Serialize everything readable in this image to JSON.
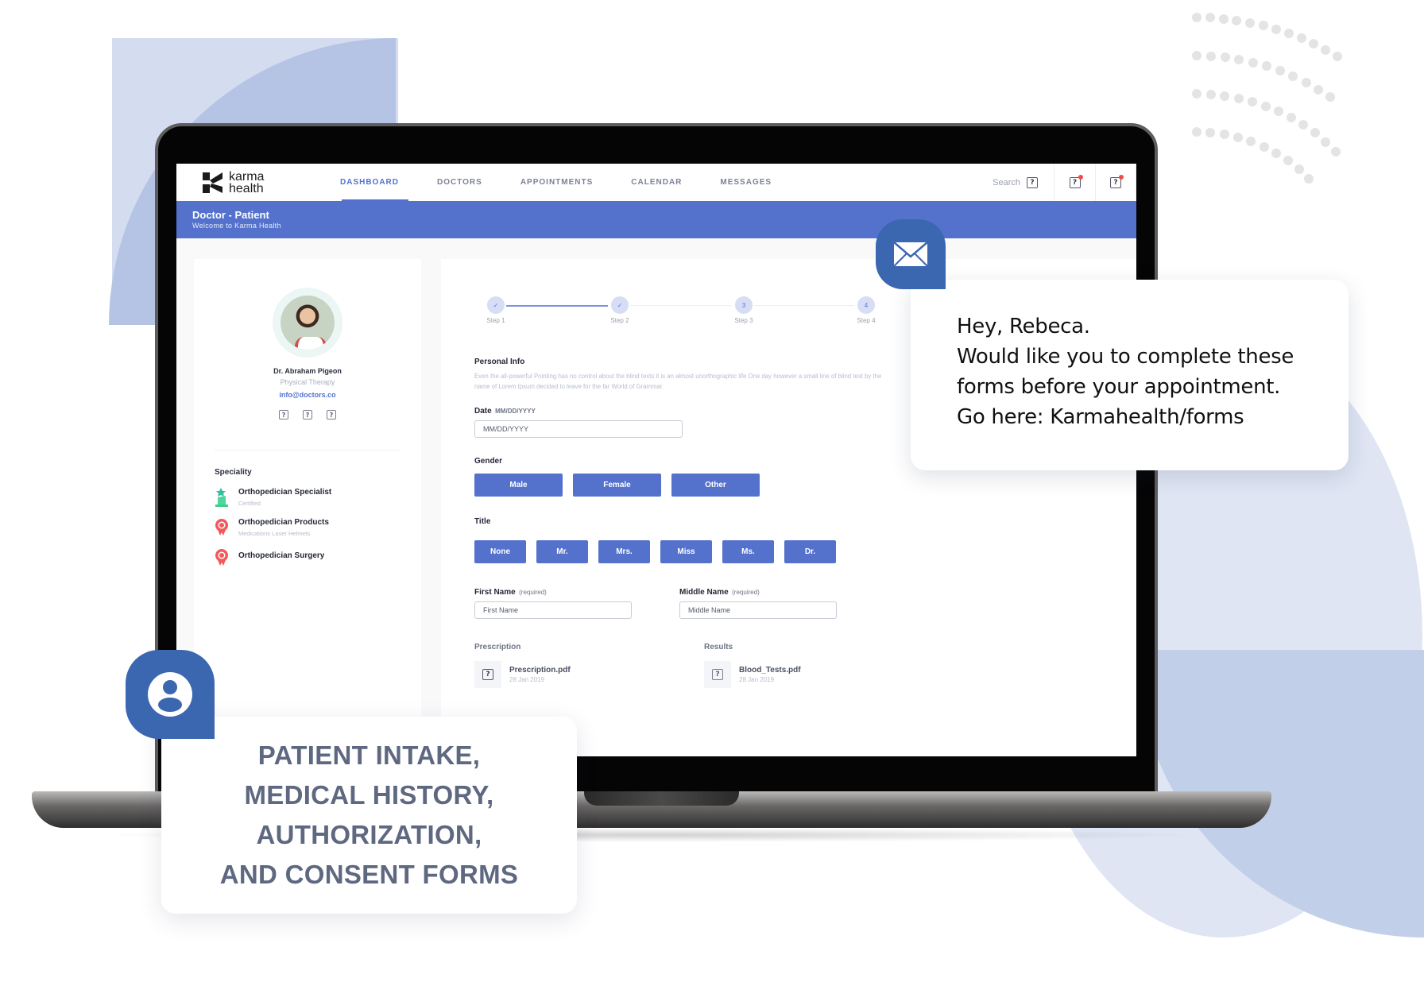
{
  "app": {
    "logo_line1": "karma",
    "logo_line2": "health",
    "nav_tabs": [
      {
        "label": "DASHBOARD",
        "active": true
      },
      {
        "label": "DOCTORS",
        "active": false
      },
      {
        "label": "APPOINTMENTS",
        "active": false
      },
      {
        "label": "CALENDAR",
        "active": false
      },
      {
        "label": "MESSAGES",
        "active": false
      }
    ],
    "search_label": "Search",
    "search_icon": "search-icon",
    "nav_icons": [
      "notifications-icon",
      "messages-icon"
    ],
    "accent_color": "#5472cc",
    "banner": {
      "title": "Doctor - Patient",
      "subtitle": "Welcome to Karma Health"
    }
  },
  "doctor": {
    "name": "Dr. Abraham Pigeon",
    "role": "Physical Therapy",
    "email": "info@doctors.co",
    "social_icons": [
      "social-icon-1",
      "social-icon-2",
      "social-icon-3"
    ],
    "speciality_title": "Speciality",
    "specialities": [
      {
        "name": "Orthopedician Specialist",
        "sub": "Certified",
        "icon": "award-trophy-icon",
        "color": "#3ecf8e"
      },
      {
        "name": "Orthopedician Products",
        "sub": "Medications Laser Helmets",
        "icon": "badge-ribbon-icon",
        "color": "#f25a5a"
      },
      {
        "name": "Orthopedician Surgery",
        "sub": "",
        "icon": "badge-ribbon-icon",
        "color": "#f25a5a"
      }
    ]
  },
  "stepper": {
    "steps": [
      {
        "label": "Step 1",
        "marker": "✓",
        "done": true
      },
      {
        "label": "Step 2",
        "marker": "✓",
        "done": true
      },
      {
        "label": "Step 3",
        "marker": "3",
        "done": false
      },
      {
        "label": "Step 4",
        "marker": "4",
        "done": false
      }
    ]
  },
  "form": {
    "section_title": "Personal Info",
    "section_desc": "Even the all-powerful Pointing has no control about the blind texts it is an almost unorthographic life One day however a small line of blind text by the name of Lorem Ipsum decided to leave for the far World of Grammar.",
    "date_label": "Date",
    "date_hint": "MM/DD/YYYY",
    "date_placeholder": "MM/DD/YYYY",
    "gender_label": "Gender",
    "gender_options": [
      "Male",
      "Female",
      "Other"
    ],
    "title_label": "Title",
    "title_options": [
      "None",
      "Mr.",
      "Mrs.",
      "Miss",
      "Ms.",
      "Dr."
    ],
    "first_name_label": "First Name",
    "first_name_hint": "(required)",
    "first_name_placeholder": "First Name",
    "middle_name_label": "Middle Name",
    "middle_name_hint": "(required)",
    "middle_name_placeholder": "Middle Name",
    "prescription_label": "Prescription",
    "results_label": "Results",
    "files": [
      {
        "name": "Prescription.pdf",
        "date": "28 Jan 2019"
      },
      {
        "name": "Blood_Tests.pdf",
        "date": "28 Jan 2019"
      }
    ]
  },
  "message_card": {
    "icon": "mail-icon",
    "lines": [
      "Hey, Rebeca.",
      "Would like you to complete these",
      "forms  before your appointment.",
      "Go here: Karmahealth/forms"
    ]
  },
  "forms_card": {
    "icon": "user-account-icon",
    "lines": [
      "PATIENT INTAKE,",
      "MEDICAL HISTORY,",
      "AUTHORIZATION,",
      "AND CONSENT FORMS"
    ]
  }
}
